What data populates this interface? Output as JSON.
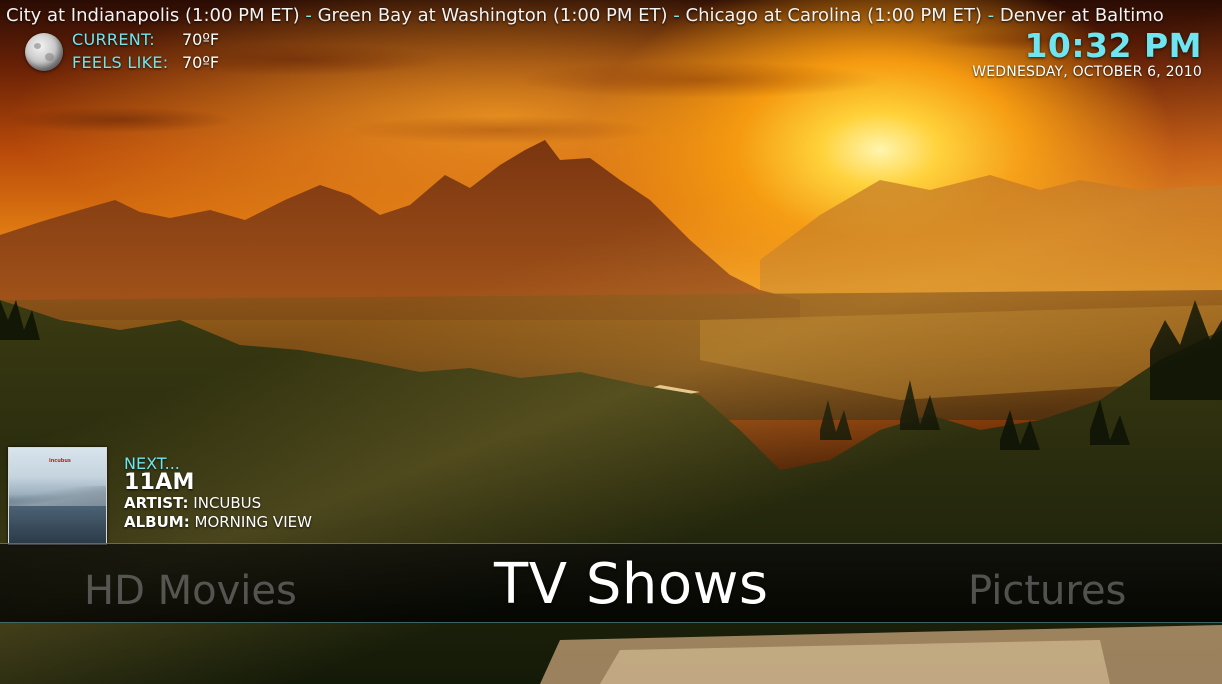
{
  "ticker": {
    "items": [
      "City at Indianapolis (1:00 PM ET)",
      "Green Bay at Washington (1:00 PM ET)",
      "Chicago at Carolina (1:00 PM ET)",
      "Denver at Baltimo"
    ],
    "separator": "-"
  },
  "weather": {
    "icon": "moon-icon",
    "current_label": "CURRENT:",
    "current_value": "70ºF",
    "feels_label": "FEELS LIKE:",
    "feels_value": "70ºF"
  },
  "clock": {
    "time": "10:32 PM",
    "date": "WEDNESDAY, OCTOBER 6, 2010"
  },
  "now_playing": {
    "next_label": "NEXT...",
    "title": "11AM",
    "artist_label": "ARTIST:",
    "artist": "INCUBUS",
    "album_label": "ALBUM:",
    "album": "MORNING VIEW",
    "cover_text": "incubus"
  },
  "menu": {
    "previous": "HD Movies",
    "current": "TV Shows",
    "next": "Pictures"
  },
  "colors": {
    "accent": "#6fe6ef",
    "text": "#ffffff"
  }
}
